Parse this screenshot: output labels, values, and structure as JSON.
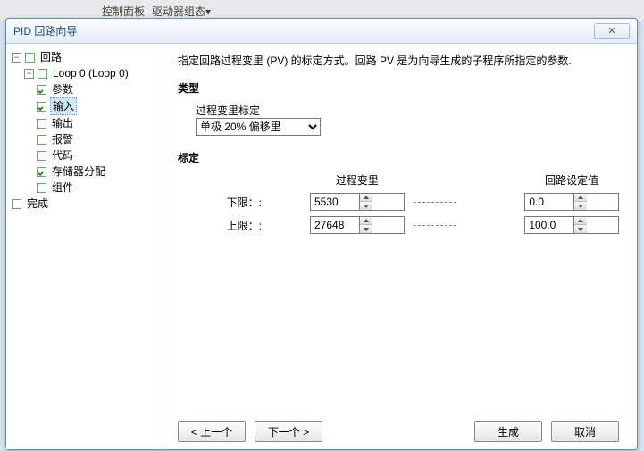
{
  "bg": {
    "menu1": "控制面板",
    "menu2": "驱动器组态▾"
  },
  "dialog": {
    "title": "PID 回路向导",
    "close": "✕"
  },
  "tree": {
    "root1": "回路",
    "loop": "Loop 0 (Loop 0)",
    "items": [
      "参数",
      "输入",
      "输出",
      "报警",
      "代码",
      "存储器分配",
      "组件"
    ],
    "checked": {
      "参数": true,
      "输入": true,
      "存储器分配": true
    },
    "done": "完成"
  },
  "content": {
    "desc": "指定回路过程变里 (PV) 的标定方式。回路 PV 是为向导生成的子程序所指定的参数.",
    "type_title": "类型",
    "type_label": "过程变里标定",
    "type_value": "单极 20% 偏移里",
    "scale_title": "标定",
    "col_pv": "过程变里",
    "col_sp": "回路设定值",
    "low_label": "下限：:",
    "high_label": "上限：:",
    "low_pv": "5530",
    "high_pv": "27648",
    "low_sp": "0.0",
    "high_sp": "100.0"
  },
  "footer": {
    "prev": "< 上一个",
    "next": "下一个 >",
    "gen": "生成",
    "cancel": "取消"
  }
}
